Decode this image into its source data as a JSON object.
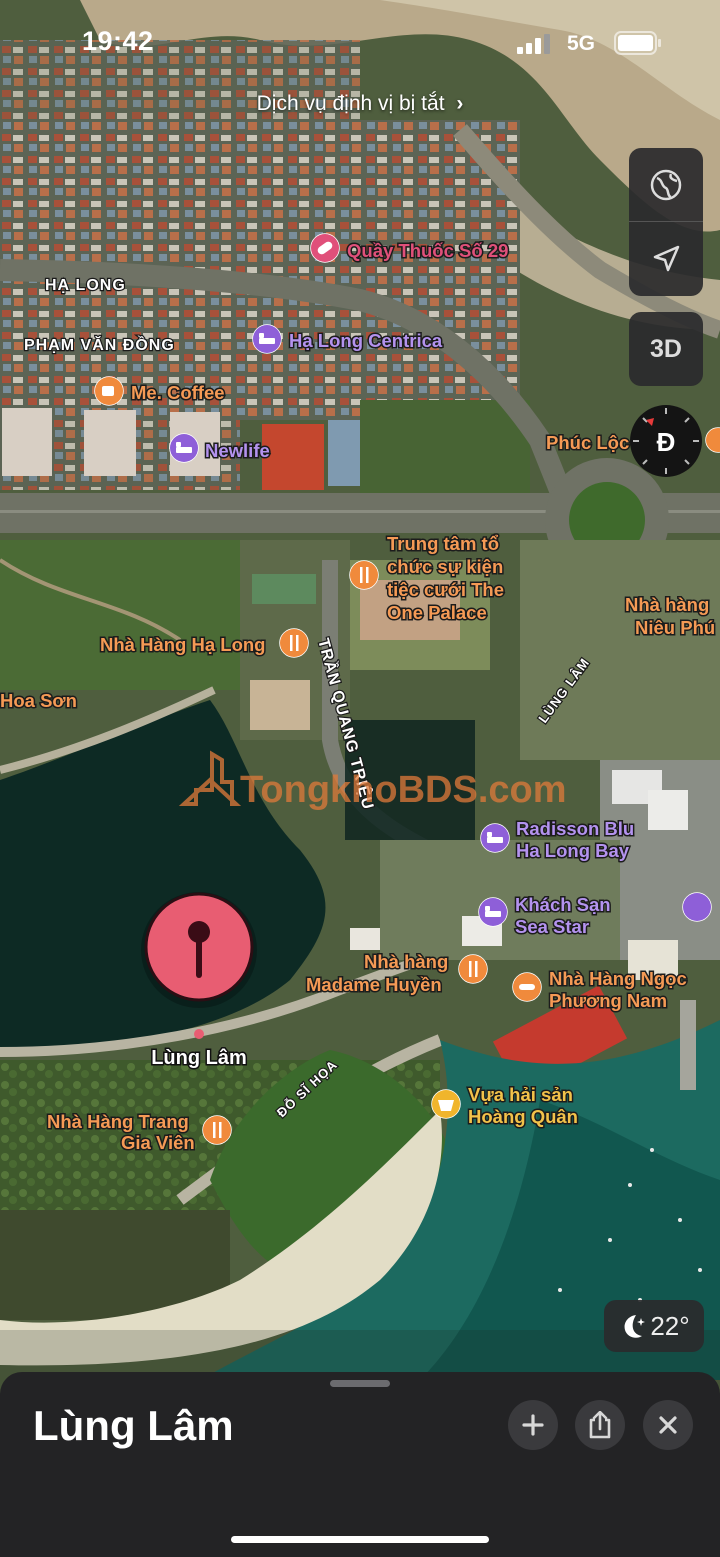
{
  "status": {
    "time": "19:42",
    "network": "5G"
  },
  "banner": {
    "text": "Dịch vụ định vị bị tắt",
    "chevron": "chevron-right-icon"
  },
  "roads": [
    {
      "id": "r1",
      "label": "HẠ LONG"
    },
    {
      "id": "r2",
      "label": "PHẠM VĂN ĐỒNG"
    },
    {
      "id": "r3",
      "label": "TRẦN QUANG TRIỆU"
    },
    {
      "id": "r4",
      "label": "LÙNG LÂM"
    },
    {
      "id": "r5",
      "label": "ĐỖ SĨ HỌA"
    }
  ],
  "pois": [
    {
      "id": "p1",
      "kind": "pharmacy",
      "icon": "pill-icon",
      "color": "#e0507a",
      "label_lines": [
        "Quầy Thuốc Số 29"
      ]
    },
    {
      "id": "p2",
      "kind": "hotel",
      "icon": "bed-icon",
      "color": "#8e5fd8",
      "label_lines": [
        "Hạ Long Centrica"
      ]
    },
    {
      "id": "p3",
      "kind": "cafe",
      "icon": "cup-icon",
      "color": "#f08a3c",
      "label_lines": [
        "Me. Coffee"
      ]
    },
    {
      "id": "p4",
      "kind": "hotel",
      "icon": "bed-icon",
      "color": "#8e5fd8",
      "label_lines": [
        "Newlife"
      ]
    },
    {
      "id": "p5",
      "kind": "place",
      "icon": "",
      "color": "#f08a3c",
      "label_lines": [
        "Phúc Lộc"
      ]
    },
    {
      "id": "p6",
      "kind": "restaurant",
      "icon": "fork-knife-icon",
      "color": "#f08a3c",
      "label_lines": [
        "Trung tâm tổ",
        "chức sự kiện",
        "tiệc cưới The",
        "One Palace"
      ]
    },
    {
      "id": "p7",
      "kind": "restaurant",
      "icon": "",
      "color": "#f08a3c",
      "label_lines": [
        "Nhà hàng",
        "Niêu Phú"
      ]
    },
    {
      "id": "p8",
      "kind": "restaurant",
      "icon": "fork-knife-icon",
      "color": "#f08a3c",
      "label_lines": [
        "Nhà Hàng Hạ Long"
      ]
    },
    {
      "id": "p9",
      "kind": "place",
      "icon": "",
      "color": "#f08a3c",
      "label_lines": [
        "Hoa Sơn"
      ]
    },
    {
      "id": "p10",
      "kind": "hotel",
      "icon": "bed-icon",
      "color": "#8e5fd8",
      "label_lines": [
        "Radisson Blu",
        "Ha Long Bay"
      ]
    },
    {
      "id": "p11",
      "kind": "hotel",
      "icon": "bed-icon",
      "color": "#8e5fd8",
      "label_lines": [
        "Khách Sạn",
        "Sea Star"
      ]
    },
    {
      "id": "p12",
      "kind": "restaurant",
      "icon": "fork-knife-icon",
      "color": "#f08a3c",
      "label_lines": [
        "Nhà hàng",
        "Madame Huyền"
      ]
    },
    {
      "id": "p13",
      "kind": "restaurant",
      "icon": "fork-knife-icon",
      "color": "#f08a3c",
      "label_lines": [
        "Nhà Hàng Trang",
        "Gia Viên"
      ]
    },
    {
      "id": "p14",
      "kind": "restaurant",
      "icon": "plate-icon",
      "color": "#f08a3c",
      "label_lines": [
        "Nhà Hàng Ngọc",
        "Phương Nam"
      ]
    },
    {
      "id": "p15",
      "kind": "market",
      "icon": "basket-icon",
      "color": "#f0b52c",
      "label_lines": [
        "Vựa hải sản",
        "Hoàng Quân"
      ]
    }
  ],
  "pin": {
    "label": "Lùng Lâm",
    "icon": "map-pin-icon",
    "color": "#e85d72"
  },
  "watermark": "TongkhoBDS.com",
  "controls": {
    "map_mode_icon": "globe-icon",
    "location_icon": "location-arrow-icon",
    "view_3d": "3D",
    "compass_letter": "Đ"
  },
  "weather": {
    "icon": "moon-stars-icon",
    "temperature": "22°"
  },
  "sheet": {
    "title": "Lùng Lâm",
    "add_icon": "plus-icon",
    "share_icon": "share-icon",
    "close_icon": "close-icon"
  }
}
